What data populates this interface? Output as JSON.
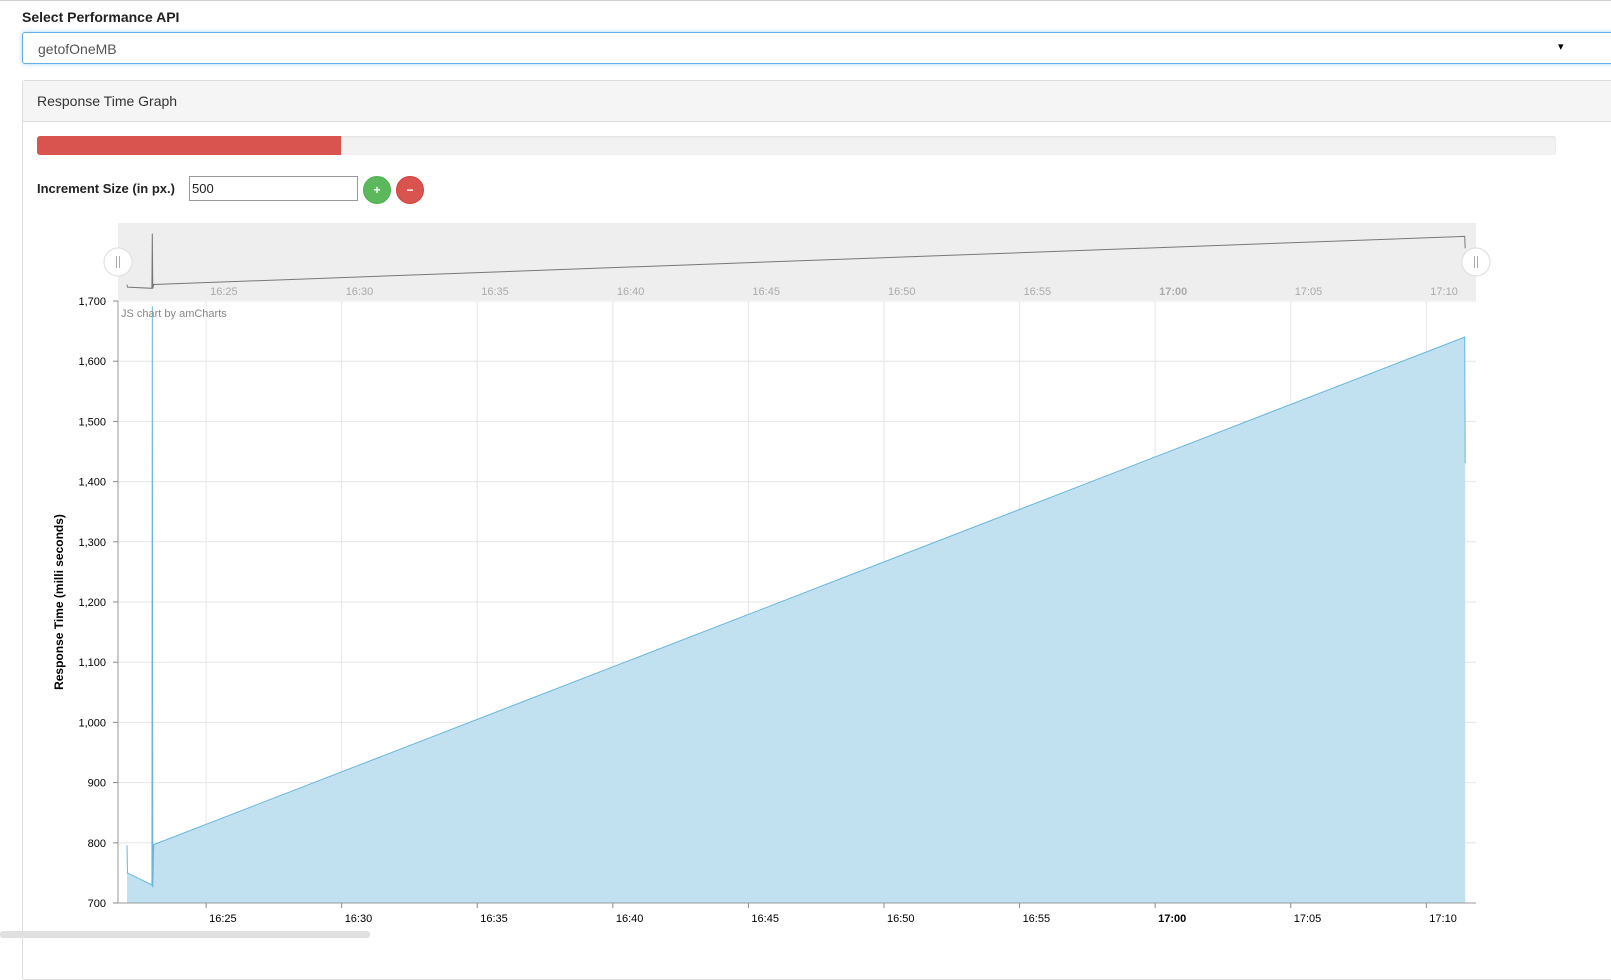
{
  "api_select": {
    "label": "Select Performance API",
    "value": "getofOneMB",
    "caret": "▾"
  },
  "panel": {
    "title": "Response Time Graph"
  },
  "progress": {
    "percent": 20,
    "color": "#d9534f"
  },
  "increment": {
    "label": "Increment Size (in px.)",
    "value": "500",
    "plus_label": "+",
    "minus_label": "−"
  },
  "chart_data": {
    "type": "area",
    "ylabel": "Response Time (milli seconds)",
    "credit": "JS chart by amCharts",
    "ylim": [
      700,
      1700
    ],
    "y_ticks": [
      700,
      800,
      900,
      1000,
      1100,
      1200,
      1300,
      1400,
      1500,
      1600,
      1700
    ],
    "y_tick_labels": [
      "700",
      "800",
      "900",
      "1,000",
      "1,100",
      "1,200",
      "1,300",
      "1,400",
      "1,500",
      "1,600",
      "1,700"
    ],
    "xlim": [
      "16:21:45",
      "17:11:50"
    ],
    "x_ticks": [
      "16:25",
      "16:30",
      "16:35",
      "16:40",
      "16:45",
      "16:50",
      "16:55",
      "17:00",
      "17:05",
      "17:10"
    ],
    "x_tick_bold": "17:00",
    "grid": true,
    "color": "#67b7dc",
    "fill_color": "#c1e0f0",
    "series": [
      {
        "x": [
          "16:22:05",
          "16:22:06",
          "16:23:00",
          "16:23:01",
          "16:23:02",
          "16:23:04",
          "17:11:25",
          "17:11:26"
        ],
        "y": [
          795,
          750,
          730,
          1690,
          727,
          797,
          1640,
          1432
        ]
      }
    ],
    "scrollbar": {
      "graph_color": "#777777",
      "background": "#eeeeee"
    }
  }
}
